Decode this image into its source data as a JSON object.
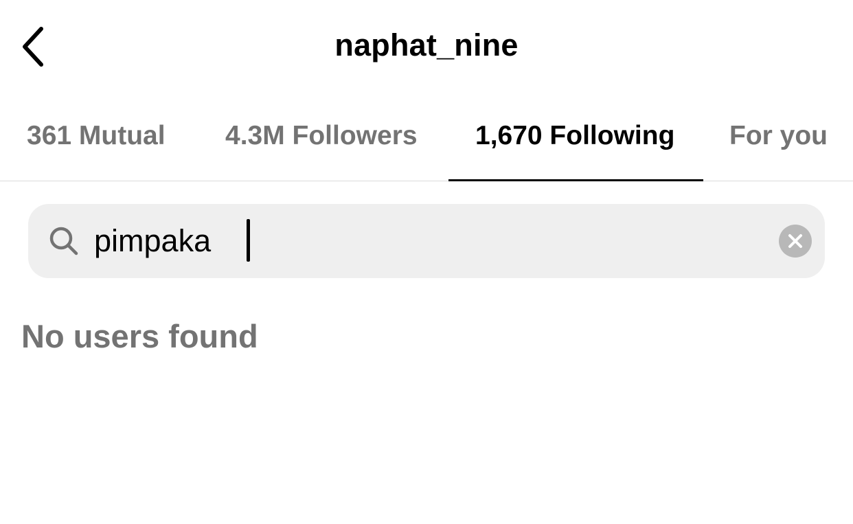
{
  "header": {
    "title": "naphat_nine",
    "back_icon": "chevron-left-icon"
  },
  "tabs": [
    {
      "label": "361 Mutual",
      "active": false
    },
    {
      "label": "4.3M Followers",
      "active": false
    },
    {
      "label": "1,670 Following",
      "active": true
    },
    {
      "label": "For you",
      "active": false
    }
  ],
  "search": {
    "value": "pimpaka",
    "icon": "search-icon",
    "clear_icon": "clear-icon"
  },
  "results": {
    "empty_message": "No users found"
  },
  "colors": {
    "active_text": "#000000",
    "inactive_text": "#737373",
    "search_bg": "#efefef",
    "divider": "#dbdbdb"
  }
}
